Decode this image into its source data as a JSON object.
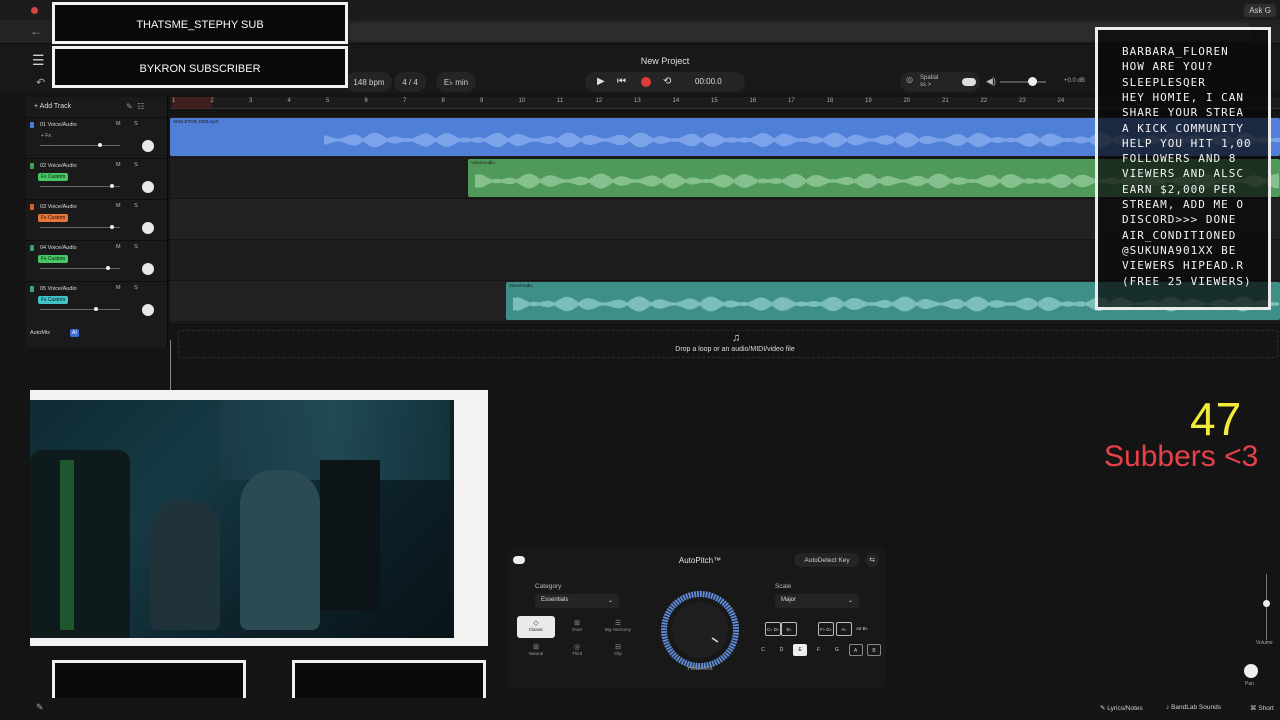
{
  "browser": {
    "ask_button": "Ask G"
  },
  "header": {
    "project_title": "New Project",
    "bpm": "148 bpm",
    "time_signature": "4 / 4",
    "key": "E♭ min",
    "time": "00:00.0",
    "spatial_label": "Spatial",
    "spatial_sub": "ss >",
    "master_db": "+0.0 dB"
  },
  "tracks_header": {
    "add_track": "+ Add Track"
  },
  "tracks": [
    {
      "name": "01 Voice/Audio",
      "fx": "+ Fx",
      "fx_style": "plain",
      "color": "#4a7dd8",
      "vol": 0.75
    },
    {
      "name": "02 Voice/Audio",
      "fx": "Fx Custom",
      "fx_style": "green",
      "color": "#3aa35a",
      "vol": 0.9
    },
    {
      "name": "03 Voice/Audio",
      "fx": "Fx Custom",
      "fx_style": "orange",
      "color": "#d8622a",
      "vol": 0.9
    },
    {
      "name": "04 Voice/Audio",
      "fx": "Fx Custom",
      "fx_style": "green",
      "color": "#3aa35a",
      "vol": 0.85
    },
    {
      "name": "05 Voice/Audio",
      "fx": "Fx Custom",
      "fx_style": "teal",
      "color": "#3aa39a",
      "vol": 0.7
    }
  ],
  "track_buttons": "M S",
  "automix": {
    "label": "AutoMix",
    "badge": "AI"
  },
  "ruler": [
    "1",
    "2",
    "3",
    "4",
    "5",
    "6",
    "7",
    "8",
    "9",
    "10",
    "11",
    "12",
    "13",
    "14",
    "15",
    "16",
    "17",
    "18",
    "19",
    "20",
    "21",
    "22",
    "23",
    "24"
  ],
  "clips": {
    "track1_label": "SKELETOR 2000.mp3",
    "clip_label": "Voice/Audio"
  },
  "drop_zone": "Drop a loop or an audio/MIDI/video file",
  "overlays": {
    "banner1": "THATSME_STEPHY SUB",
    "banner2": "BYKRON SUBSCRIBER",
    "chat": [
      "BARBARA_FLOREN",
      "HOW ARE YOU?",
      "SLEEPLESQER",
      "HEY HOMIE, I CAN",
      "SHARE YOUR STREA",
      "A KICK COMMUNITY",
      "HELP YOU HIT 1,00",
      "FOLLOWERS AND 8",
      "VIEWERS AND ALSC",
      "EARN $2,000 PER",
      "STREAM, ADD ME O",
      "DISCORD>>> DONE",
      "AIR_CONDITIONED",
      "@SUKUNA901XX BE",
      "VIEWERS HIPEAD.R",
      "(FREE 25 VIEWERS)"
    ],
    "counter_number": "47",
    "counter_label": "Subbers <3"
  },
  "autopitch": {
    "title": "AutoPitch™",
    "autodetect": "AutoDetect Key",
    "category_label": "Category",
    "category_value": "Essentials",
    "presets": [
      "Classic",
      "Duet",
      "Big Harmony",
      "Natural",
      "Third",
      "Clip"
    ],
    "dial_label": "Heaviest",
    "scale_label": "Scale",
    "scale_value": "Major",
    "chord_buttons": [
      "C♭ D♭",
      "E♭",
      "F♭ G♭",
      "A♭",
      "A♯ B♭"
    ],
    "keys": [
      "C",
      "D",
      "E",
      "F",
      "G",
      "A",
      "B"
    ],
    "selected_key": "E"
  },
  "right_strip": {
    "volume": "Volume",
    "pan": "Pan"
  },
  "bottom_bar": {
    "lyrics": "Lyrics/Notes",
    "sounds": "BandLab Sounds",
    "shortcuts": "Short"
  },
  "colors": {
    "track_blue": "#4f7fd6",
    "track_green": "#4f9a5a",
    "track_teal": "#3e8f88",
    "record_red": "#e03b3b",
    "counter_yellow": "#f3eb3a",
    "counter_red": "#e8404a"
  }
}
